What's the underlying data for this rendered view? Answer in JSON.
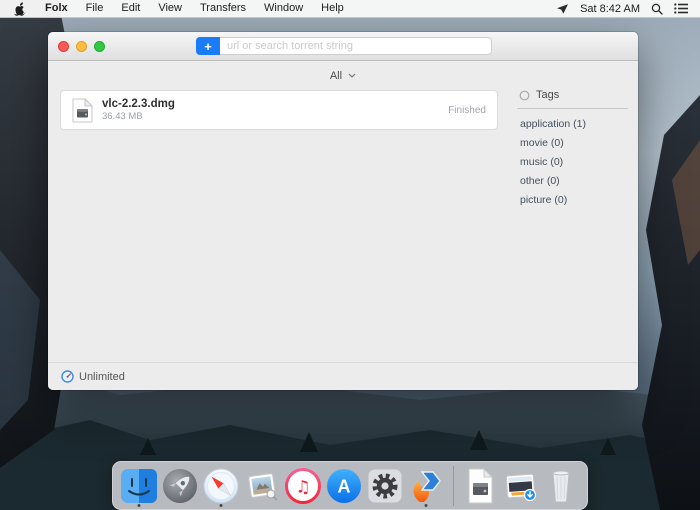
{
  "menu_bar": {
    "items": [
      "Folx",
      "File",
      "Edit",
      "View",
      "Transfers",
      "Window",
      "Help"
    ],
    "clock": "Sat 8:42 AM"
  },
  "window": {
    "toolbar": {
      "add_button": "+",
      "search_placeholder": "url or search torrent string"
    },
    "filter": {
      "selected": "All"
    },
    "downloads": [
      {
        "name": "vlc-2.2.3.dmg",
        "size": "36.43 MB",
        "status": "Finished"
      }
    ],
    "sidebar": {
      "header": "Tags",
      "tags": [
        "application (1)",
        "movie (0)",
        "music (0)",
        "other (0)",
        "picture (0)"
      ]
    },
    "status_bar": {
      "speed": "Unlimited"
    }
  },
  "dock": {
    "apps": [
      "finder",
      "launchpad",
      "safari",
      "preview",
      "itunes",
      "app-store",
      "system-preferences",
      "folx",
      "dmg-file",
      "downloads-stack",
      "trash"
    ],
    "running": [
      "finder",
      "safari",
      "folx"
    ]
  },
  "colors": {
    "accent_blue": "#1a7cf9",
    "status_gray": "#a0a4ab"
  }
}
